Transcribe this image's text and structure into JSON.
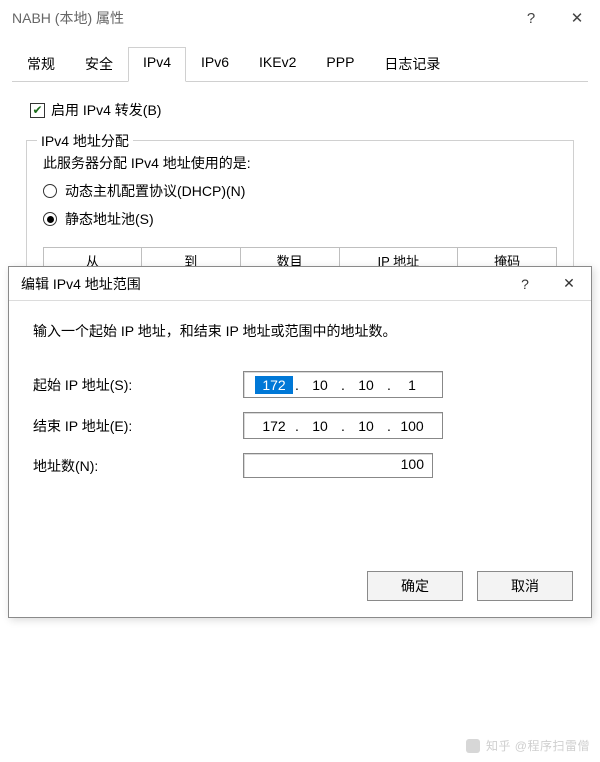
{
  "window": {
    "title": "NABH (本地) 属性",
    "controls": {
      "help": "?",
      "close": "✕"
    }
  },
  "tabs": {
    "items": [
      {
        "label": "常规"
      },
      {
        "label": "安全"
      },
      {
        "label": "IPv4"
      },
      {
        "label": "IPv6"
      },
      {
        "label": "IKEv2"
      },
      {
        "label": "PPP"
      },
      {
        "label": "日志记录"
      }
    ],
    "activeIndex": 2
  },
  "ipv4": {
    "enableForward": {
      "label": "启用 IPv4 转发(B)",
      "checked": true
    },
    "group": {
      "legend": "IPv4 地址分配",
      "subtitle": "此服务器分配 IPv4 地址使用的是:",
      "radios": {
        "dhcp": {
          "label": "动态主机配置协议(DHCP)(N)",
          "selected": false
        },
        "static": {
          "label": "静态地址池(S)",
          "selected": true
        }
      },
      "columns": [
        "从",
        "到",
        "数目",
        "IP 地址",
        "掩码"
      ]
    }
  },
  "dialog": {
    "title": "编辑 IPv4 地址范围",
    "controls": {
      "help": "?",
      "close": "✕"
    },
    "message": "输入一个起始 IP 地址，和结束 IP 地址或范围中的地址数。",
    "startLabel": "起始 IP 地址(S):",
    "startIP": {
      "a": "172",
      "b": "10",
      "c": "10",
      "d": "1"
    },
    "endLabel": "结束 IP 地址(E):",
    "endIP": {
      "a": "172",
      "b": "10",
      "c": "10",
      "d": "100"
    },
    "countLabel": "地址数(N):",
    "count": "100",
    "ok": "确定",
    "cancel": "取消"
  },
  "watermark": {
    "text": "知乎 @程序扫雷僧"
  }
}
